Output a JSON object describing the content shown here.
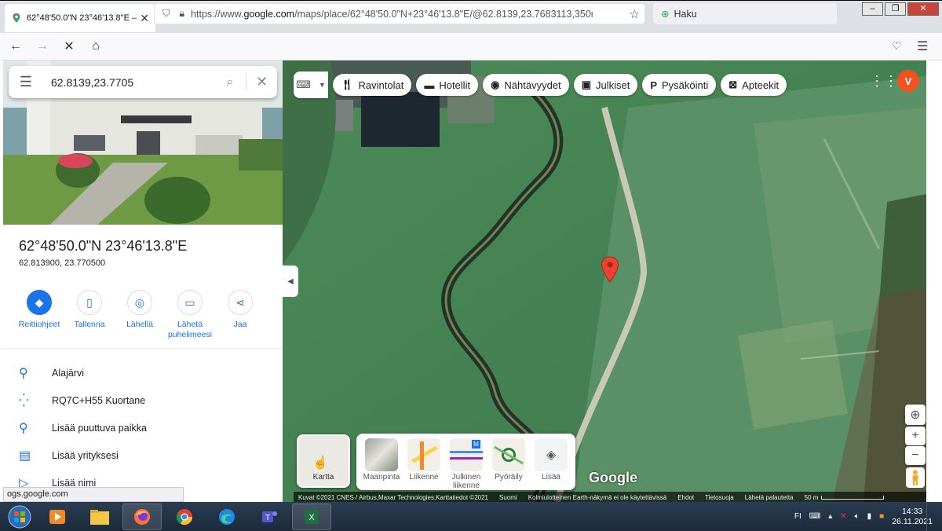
{
  "browser": {
    "tab_title": "62°48'50.0\"N 23°46'13.8\"E – Goo",
    "url_prefix": "https://www.",
    "url_domain": "google.com",
    "url_rest": "/maps/place/62°48'50.0\"N+23°46'13.8\"E/@62.8139,23.7683113,350m/data=",
    "search_placeholder": "Haku",
    "status_url": "ogs.google.com"
  },
  "search": {
    "query": "62.8139,23.7705"
  },
  "place": {
    "title": "62°48'50.0\"N 23°46'13.8\"E",
    "coords": "62.813900, 23.770500"
  },
  "actions": [
    {
      "label": "Reittiohjeet"
    },
    {
      "label": "Tallenna"
    },
    {
      "label": "Lähellä"
    },
    {
      "label": "Lähetä puhelimeesi"
    },
    {
      "label": "Jaa"
    }
  ],
  "info_rows": [
    {
      "text": "Alajärvi",
      "icon": "location-pin-icon"
    },
    {
      "text": "RQ7C+H55 Kuortane",
      "icon": "plus-code-icon"
    },
    {
      "text": "Lisää puuttuva paikka",
      "icon": "add-place-icon"
    },
    {
      "text": "Lisää yrityksesi",
      "icon": "add-business-icon"
    },
    {
      "text": "Lisää nimi",
      "icon": "label-icon"
    }
  ],
  "chips": [
    {
      "label": "Ravintolat"
    },
    {
      "label": "Hotellit"
    },
    {
      "label": "Nähtävyydet"
    },
    {
      "label": "Julkiset"
    },
    {
      "label": "Pysäköinti"
    },
    {
      "label": "Apteekit"
    }
  ],
  "avatar_letter": "V",
  "map_type_toggle": {
    "label": "Kartta"
  },
  "layers": [
    {
      "label": "Maanpinta"
    },
    {
      "label": "Liikenne"
    },
    {
      "label": "Julkinen liikenne"
    },
    {
      "label": "Pyöräily"
    },
    {
      "label": "Lisää"
    }
  ],
  "google_logo": "Google",
  "footer": {
    "attribution": "Kuvat ©2021 CNES / Airbus,Maxar Technologies,Karttatiedot ©2021",
    "country": "Suomi",
    "earth_note": "Kolmiulotteinen Earth-näkymä ei ole käytettävissä",
    "terms": "Ehdot",
    "privacy": "Tietosuoja",
    "feedback": "Lähetä palautetta",
    "scale": "50 m"
  },
  "taskbar": {
    "lang": "FI",
    "time": "14:33",
    "date": "26.11.2021"
  },
  "colors": {
    "accent": "#1a73e8",
    "pin": "#ea4335",
    "avatar": "#f4511e"
  }
}
